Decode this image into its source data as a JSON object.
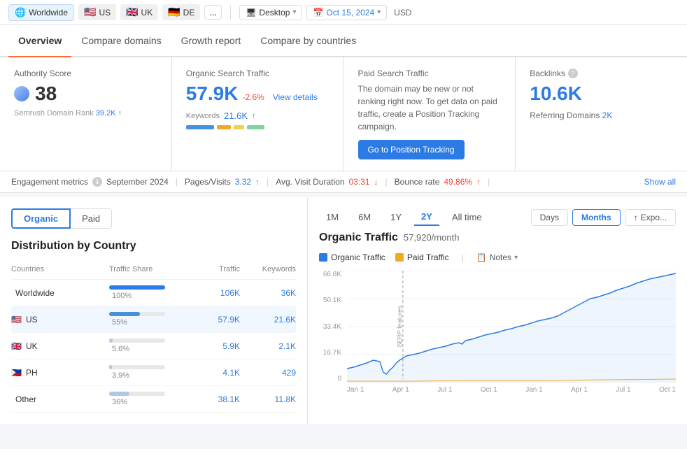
{
  "topbar": {
    "worldwide_label": "Worldwide",
    "us_label": "US",
    "uk_label": "UK",
    "de_label": "DE",
    "more_label": "...",
    "device_label": "Desktop",
    "date_label": "Oct 15, 2024",
    "currency_label": "USD"
  },
  "nav": {
    "tabs": [
      "Overview",
      "Compare domains",
      "Growth report",
      "Compare by countries"
    ]
  },
  "metrics": {
    "authority_score": {
      "label": "Authority Score",
      "value": "38",
      "domain_rank_label": "Semrush Domain Rank",
      "domain_rank_value": "39.2K",
      "domain_rank_arrow": "↑"
    },
    "organic": {
      "label": "Organic Search Traffic",
      "value": "57.9K",
      "change": "-2.6%",
      "view_details": "View details",
      "keywords_label": "Keywords",
      "keywords_value": "21.6K",
      "keywords_arrow": "↑"
    },
    "paid": {
      "label": "Paid Search Traffic",
      "desc": "The domain may be new or not ranking right now. To get data on paid traffic, create a Position Tracking campaign.",
      "btn_label": "Go to Position Tracking"
    },
    "backlinks": {
      "label": "Backlinks",
      "value": "10.6K",
      "referring_label": "Referring Domains",
      "referring_value": "2K"
    }
  },
  "engagement": {
    "label": "Engagement metrics",
    "period": "September 2024",
    "pages_label": "Pages/Visits",
    "pages_value": "3.32",
    "pages_dir": "up",
    "duration_label": "Avg. Visit Duration",
    "duration_value": "03:31",
    "duration_dir": "down",
    "bounce_label": "Bounce rate",
    "bounce_value": "49.86%",
    "bounce_dir": "up",
    "show_all": "Show all"
  },
  "left_panel": {
    "toggle_organic": "Organic",
    "toggle_paid": "Paid",
    "section_title": "Distribution by Country",
    "table_headers": [
      "Countries",
      "Traffic Share",
      "Traffic",
      "Keywords"
    ],
    "rows": [
      {
        "flag": "",
        "name": "Worldwide",
        "bar_pct": 100,
        "pct": "100%",
        "traffic": "106K",
        "keywords": "36K",
        "highlight": false
      },
      {
        "flag": "🇺🇸",
        "name": "US",
        "bar_pct": 55,
        "pct": "55%",
        "traffic": "57.9K",
        "keywords": "21.6K",
        "highlight": true
      },
      {
        "flag": "🇬🇧",
        "name": "UK",
        "bar_pct": 6,
        "pct": "5.6%",
        "traffic": "5.9K",
        "keywords": "2.1K",
        "highlight": false
      },
      {
        "flag": "🇵🇭",
        "name": "PH",
        "bar_pct": 4,
        "pct": "3.9%",
        "traffic": "4.1K",
        "keywords": "429",
        "highlight": false
      },
      {
        "flag": "",
        "name": "Other",
        "bar_pct": 36,
        "pct": "36%",
        "traffic": "38.1K",
        "keywords": "11.8K",
        "highlight": false
      }
    ]
  },
  "right_panel": {
    "time_options": [
      "1M",
      "6M",
      "1Y",
      "2Y",
      "All time"
    ],
    "active_time": "2Y",
    "view_days": "Days",
    "view_months": "Months",
    "export_label": "Expo...",
    "organic_title": "Organic Traffic",
    "organic_value": "57,920/month",
    "legend": {
      "organic": "Organic Traffic",
      "paid": "Paid Traffic",
      "notes": "Notes"
    },
    "y_labels": [
      "66.8K",
      "50.1K",
      "33.4K",
      "16.7K",
      "0"
    ],
    "x_labels": [
      "Jan 1",
      "Apr 1",
      "Jul 1",
      "Oct 1",
      "Jan 1",
      "Apr 1",
      "Jul 1",
      "Oct 1"
    ],
    "serp_label": "SERP features"
  }
}
